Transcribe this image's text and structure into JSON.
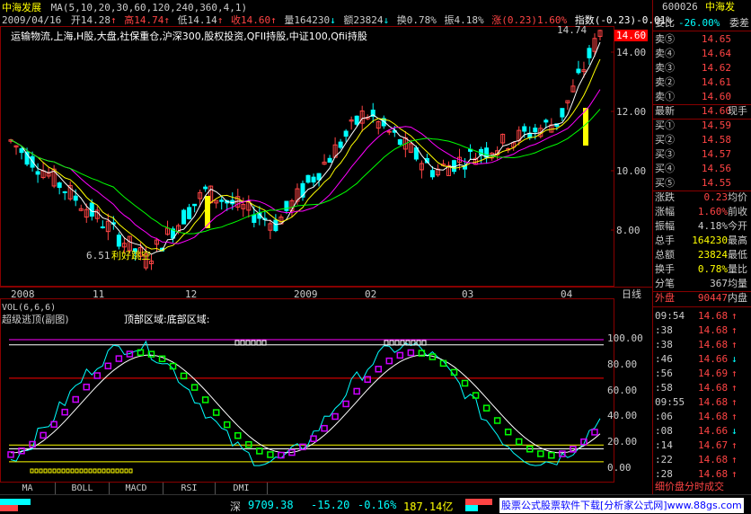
{
  "header": {
    "stock_name": "中海发展",
    "ma_params": "MA(5,10,20,30,60,120,240,360,4,1)",
    "date": "2009/04/16",
    "open": "开14.28",
    "high": "高14.74",
    "low": "低14.14",
    "close": "收14.60",
    "volume": "量164230",
    "amount": "额23824",
    "turnover": "换0.78%",
    "amplitude": "振4.18%",
    "change": "涨(0.23)1.60%",
    "index": "指数(-0.23)-0.01%",
    "concepts": "运输物流,上海,H股,大盘,社保重仓,沪深300,股权投资,QFII持股,中证100,Qfii持股"
  },
  "price_axis": {
    "labels": [
      "14.00",
      "12.00",
      "10.00",
      "8.00"
    ],
    "current_price_tag": "14.60",
    "high_marker": "14.74",
    "low_marker": "6.51",
    "annotation": "利好跳空"
  },
  "time_axis": [
    "2008",
    "11",
    "12",
    "2009",
    "02",
    "03",
    "04"
  ],
  "period_label": "日线",
  "indicator": {
    "vol_label": "VOL(6,6,6)",
    "name": "超级逃顶(副图)",
    "zone_label": "顶部区域:底部区域:",
    "axis": [
      "100.00",
      "80.00",
      "60.00",
      "40.00",
      "20.00",
      "0.00"
    ]
  },
  "tabs": [
    "MA",
    "BOLL",
    "MACD",
    "RSI",
    "DMI"
  ],
  "quote_panel": {
    "code": "600026",
    "name": "中海发",
    "weibi": "委比",
    "weibi_val": "-26.00%",
    "weicha": "委差",
    "sell": [
      {
        "label": "卖⑤",
        "price": "14.65"
      },
      {
        "label": "卖④",
        "price": "14.64"
      },
      {
        "label": "卖③",
        "price": "14.62"
      },
      {
        "label": "卖②",
        "price": "14.61"
      },
      {
        "label": "卖①",
        "price": "14.60"
      }
    ],
    "latest_label": "最新",
    "latest": "14.60",
    "xianshou": "现手",
    "buy": [
      {
        "label": "买①",
        "price": "14.59"
      },
      {
        "label": "买②",
        "price": "14.58"
      },
      {
        "label": "买③",
        "price": "14.57"
      },
      {
        "label": "买④",
        "price": "14.56"
      },
      {
        "label": "买⑤",
        "price": "14.55"
      }
    ],
    "stats": [
      {
        "label": "涨跌",
        "value": "0.23",
        "extra": "均价"
      },
      {
        "label": "涨幅",
        "value": "1.60%",
        "extra": "前收"
      },
      {
        "label": "振幅",
        "value": "4.18%",
        "extra": "今开"
      },
      {
        "label": "总手",
        "value": "164230",
        "extra": "最高"
      },
      {
        "label": "总额",
        "value": "23824",
        "extra": "最低"
      },
      {
        "label": "换手",
        "value": "0.78%",
        "extra": "量比"
      },
      {
        "label": "分笔",
        "value": "367",
        "extra": "均量"
      }
    ],
    "outer_label": "外盘",
    "outer_value": "90447",
    "inner_label": "内盘",
    "ticks": [
      {
        "t": "09:54",
        "p": "14.68",
        "a": "↑"
      },
      {
        "t": ":38",
        "p": "14.68",
        "a": "↑"
      },
      {
        "t": ":38",
        "p": "14.68",
        "a": "↑"
      },
      {
        "t": ":46",
        "p": "14.66",
        "a": "↓"
      },
      {
        "t": ":56",
        "p": "14.69",
        "a": "↑"
      },
      {
        "t": ":58",
        "p": "14.68",
        "a": "↑"
      },
      {
        "t": "09:55",
        "p": "14.68",
        "a": "↑"
      },
      {
        "t": ":06",
        "p": "14.68",
        "a": "↑"
      },
      {
        "t": ":08",
        "p": "14.66",
        "a": "↓"
      },
      {
        "t": ":14",
        "p": "14.67",
        "a": "↑"
      },
      {
        "t": ":22",
        "p": "14.68",
        "a": "↑"
      },
      {
        "t": ":28",
        "p": "14.68",
        "a": "↑"
      }
    ],
    "bottom_tabs": "细价盘分时成交"
  },
  "status": {
    "market": "深",
    "index": "9709.38",
    "change": "-15.20",
    "pct": "-0.16%",
    "amount": "187.14亿",
    "ad": "股票公式股票软件下载[分析家公式网]www.88gs.com"
  },
  "colors": {
    "up": "#ff4444",
    "down": "#00ffff",
    "ma5": "#ffffff",
    "ma10": "#ffff00",
    "ma20": "#ff00ff",
    "ma30": "#00ff00"
  }
}
